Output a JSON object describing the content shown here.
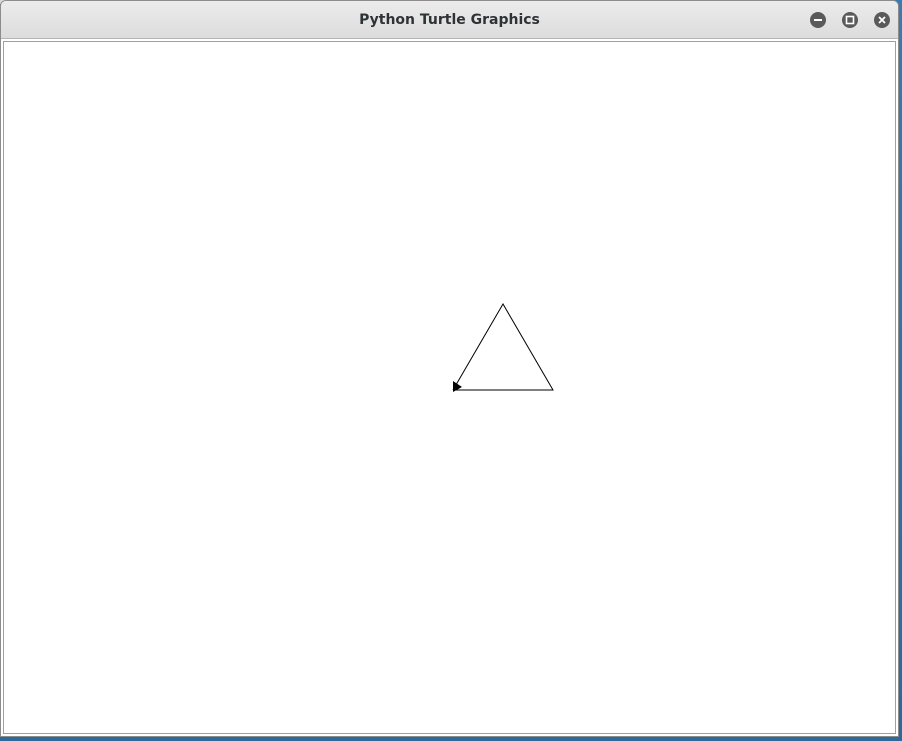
{
  "window": {
    "title": "Python Turtle Graphics"
  },
  "controls": {
    "minimize_icon": "minimize-icon",
    "maximize_icon": "maximize-icon",
    "close_icon": "close-icon"
  },
  "canvas": {
    "background": "#ffffff",
    "pen_color": "#000000",
    "drawing": "triangle",
    "turtle_shape": "classic-arrow"
  }
}
